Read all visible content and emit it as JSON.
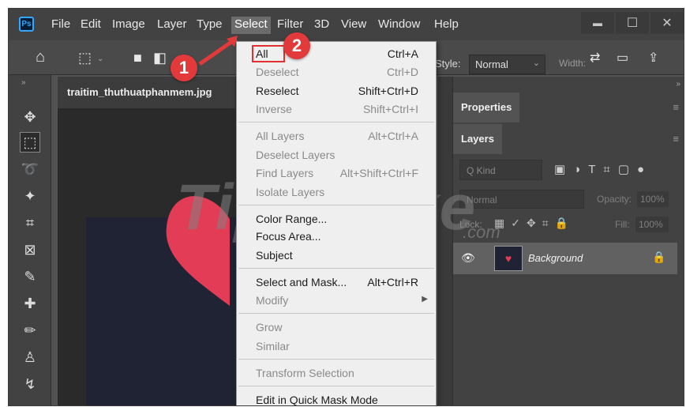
{
  "menubar": {
    "logo": "Ps",
    "items": [
      "File",
      "Edit",
      "Image",
      "Layer",
      "Type",
      "Select",
      "Filter",
      "3D",
      "View",
      "Window",
      "Help"
    ],
    "active_item": "Select"
  },
  "window_controls": {
    "minimize": "▬",
    "maximize": "☐",
    "close": "✕"
  },
  "options_bar": {
    "style_label": "Style:",
    "style_value": "Normal",
    "width_label": "Width:"
  },
  "document": {
    "tab_label": "traitim_thuthuatphanmem.jpg"
  },
  "panels": {
    "properties_tab": "Properties",
    "layers_tab": "Layers",
    "kind_placeholder": "Q Kind",
    "blend_mode": "Normal",
    "opacity_label": "Opacity:",
    "opacity_value": "100%",
    "lock_label": "Lock:",
    "fill_label": "Fill:",
    "fill_value": "100%",
    "layer_name": "Background"
  },
  "watermark": {
    "text": "TipsMake",
    "sub": ".com"
  },
  "select_menu": {
    "items": [
      {
        "label": "All",
        "shortcut": "Ctrl+A",
        "enabled": true
      },
      {
        "label": "Deselect",
        "shortcut": "Ctrl+D",
        "enabled": false
      },
      {
        "label": "Reselect",
        "shortcut": "Shift+Ctrl+D",
        "enabled": true
      },
      {
        "label": "Inverse",
        "shortcut": "Shift+Ctrl+I",
        "enabled": false
      },
      {
        "label": "All Layers",
        "shortcut": "Alt+Ctrl+A",
        "enabled": false
      },
      {
        "label": "Deselect Layers",
        "shortcut": "",
        "enabled": false
      },
      {
        "label": "Find Layers",
        "shortcut": "Alt+Shift+Ctrl+F",
        "enabled": false
      },
      {
        "label": "Isolate Layers",
        "shortcut": "",
        "enabled": false
      },
      {
        "label": "Color Range...",
        "shortcut": "",
        "enabled": true
      },
      {
        "label": "Focus Area...",
        "shortcut": "",
        "enabled": true
      },
      {
        "label": "Subject",
        "shortcut": "",
        "enabled": true
      },
      {
        "label": "Select and Mask...",
        "shortcut": "Alt+Ctrl+R",
        "enabled": true
      },
      {
        "label": "Modify",
        "shortcut": "",
        "enabled": false
      },
      {
        "label": "Grow",
        "shortcut": "",
        "enabled": false
      },
      {
        "label": "Similar",
        "shortcut": "",
        "enabled": false
      },
      {
        "label": "Transform Selection",
        "shortcut": "",
        "enabled": false
      },
      {
        "label": "Edit in Quick Mask Mode",
        "shortcut": "",
        "enabled": true
      }
    ]
  },
  "callouts": {
    "step1": "1",
    "step2": "2"
  },
  "colors": {
    "accent_red": "#e23a3a",
    "heart": "#e23c56",
    "ps_blue": "#31a8ff"
  }
}
